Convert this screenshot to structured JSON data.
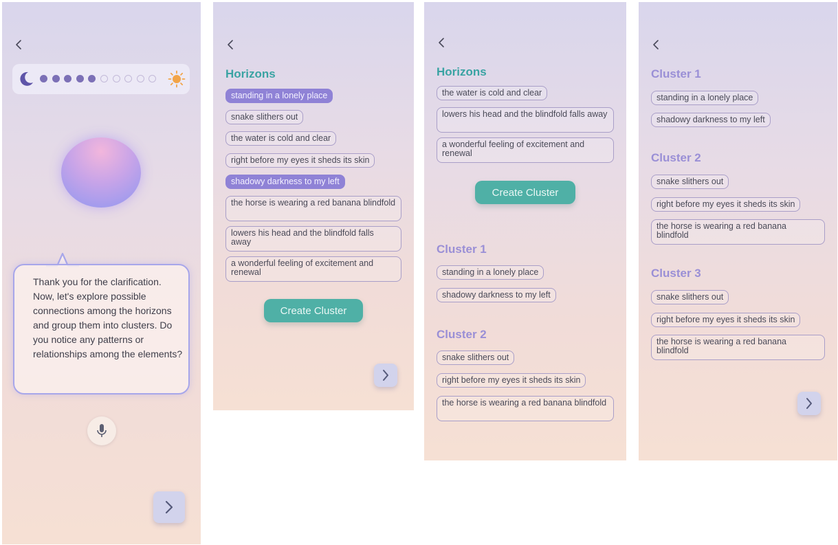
{
  "screen1": {
    "progress": {
      "filled": 5,
      "total": 10,
      "start_icon": "moon-icon",
      "end_icon": "sun-icon"
    },
    "message": "Thank you for the clarification. Now, let's explore possible connections among the horizons and group them into clusters. Do you notice any patterns or relationships among the elements?",
    "mic_icon": "microphone-icon",
    "next_icon": "chevron-right-icon"
  },
  "screen2": {
    "title": "Horizons",
    "chips": [
      {
        "text": "standing in a lonely place",
        "selected": true
      },
      {
        "text": "snake slithers out",
        "selected": false
      },
      {
        "text": "the water is cold and clear",
        "selected": false
      },
      {
        "text": "right before my eyes it sheds its skin",
        "selected": false
      },
      {
        "text": "shadowy darkness to my left",
        "selected": true
      },
      {
        "text": "the horse is wearing a red banana blindfold",
        "selected": false
      },
      {
        "text": "lowers his head and the blindfold falls away",
        "selected": false
      },
      {
        "text": "a wonderful feeling of excitement and renewal",
        "selected": false
      }
    ],
    "create_label": "Create Cluster"
  },
  "screen3": {
    "title": "Horizons",
    "chips": [
      "the water is cold and clear",
      "lowers his head and the blindfold falls away",
      "a wonderful feeling of excitement and renewal"
    ],
    "create_label": "Create Cluster",
    "clusters": [
      {
        "title": "Cluster 1",
        "items": [
          "standing in a lonely place",
          "shadowy darkness to my left"
        ]
      },
      {
        "title": "Cluster 2",
        "items": [
          "snake slithers out",
          "right before my eyes it sheds its skin",
          "the horse is wearing a red banana blindfold"
        ]
      }
    ]
  },
  "screen4": {
    "clusters": [
      {
        "title": "Cluster 1",
        "items": [
          "standing in a lonely place",
          "shadowy darkness to my left"
        ]
      },
      {
        "title": "Cluster 2",
        "items": [
          "snake slithers out",
          "right before my eyes it sheds its skin",
          "the horse is wearing a red banana blindfold"
        ]
      },
      {
        "title": "Cluster 3",
        "items": [
          "snake slithers out",
          "right before my eyes it sheds its skin",
          "the horse is wearing a red banana blindfold"
        ]
      }
    ]
  },
  "colors": {
    "teal": "#3aa3a3",
    "purple": "#9a8fd6",
    "selected_chip": "#8f82d6",
    "button": "#4fb0a6"
  }
}
